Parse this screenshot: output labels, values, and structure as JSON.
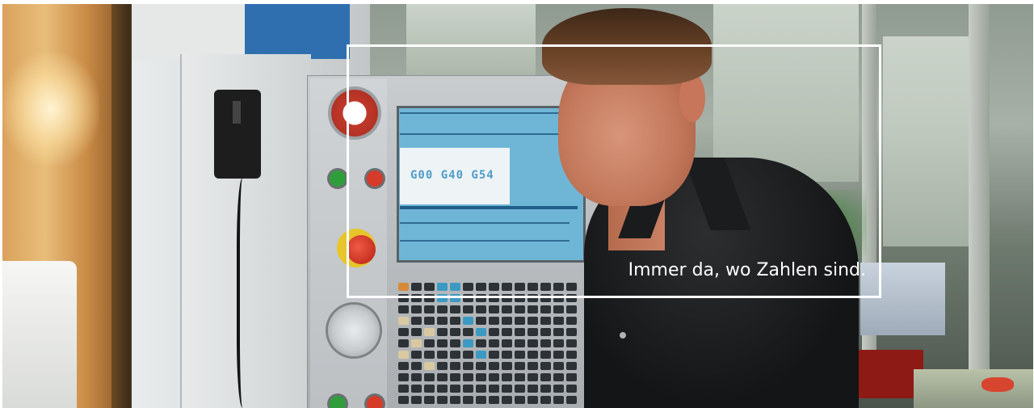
{
  "hero": {
    "headline": "Immer da, wo Zahlen sind.",
    "screen_code": "G00 G40 G54",
    "colors": {
      "frame": "#ffffff",
      "headline": "#ffffff"
    }
  }
}
